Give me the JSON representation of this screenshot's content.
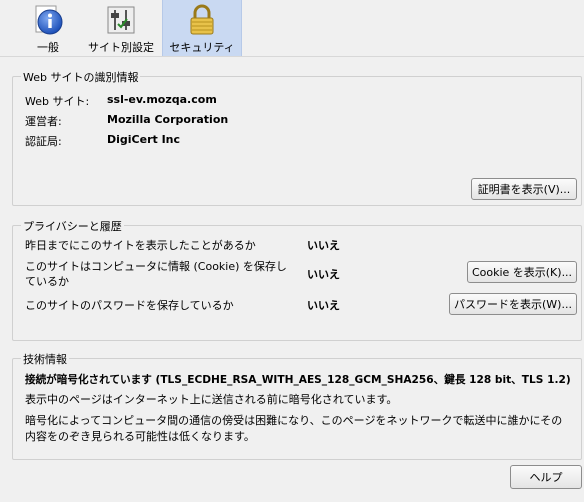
{
  "toolbar": {
    "tabs": [
      {
        "label": "一般"
      },
      {
        "label": "サイト別設定"
      },
      {
        "label": "セキュリティ"
      }
    ]
  },
  "identity": {
    "title": "Web サイトの識別情報",
    "website_label": "Web サイト:",
    "website_value": "ssl-ev.mozqa.com",
    "owner_label": "運営者:",
    "owner_value": "Mozilla Corporation",
    "verifier_label": "認証局:",
    "verifier_value": "DigiCert Inc",
    "view_cert_button": "証明書を表示(V)..."
  },
  "privacy": {
    "title": "プライバシーと履歴",
    "visited_q": "昨日までにこのサイトを表示したことがあるか",
    "visited_a": "いいえ",
    "cookie_q_line1": "このサイトはコンピュータに情報 (Cookie) を保存し",
    "cookie_q_line2": "ているか",
    "cookie_a": "いいえ",
    "cookie_button": "Cookie を表示(K)...",
    "password_q": "このサイトのパスワードを保存しているか",
    "password_a": "いいえ",
    "password_button": "パスワードを表示(W)..."
  },
  "technical": {
    "title": "技術情報",
    "encryption": "接続が暗号化されています (TLS_ECDHE_RSA_WITH_AES_128_GCM_SHA256、鍵長 128 bit、TLS 1.2)",
    "line2": "表示中のページはインターネット上に送信される前に暗号化されています。",
    "line3": "暗号化によってコンピュータ間の通信の傍受は困難になり、このページをネットワークで転送中に誰かにその",
    "line4": "内容をのぞき見られる可能性は低くなります。"
  },
  "footer": {
    "help_button": "ヘルプ"
  }
}
